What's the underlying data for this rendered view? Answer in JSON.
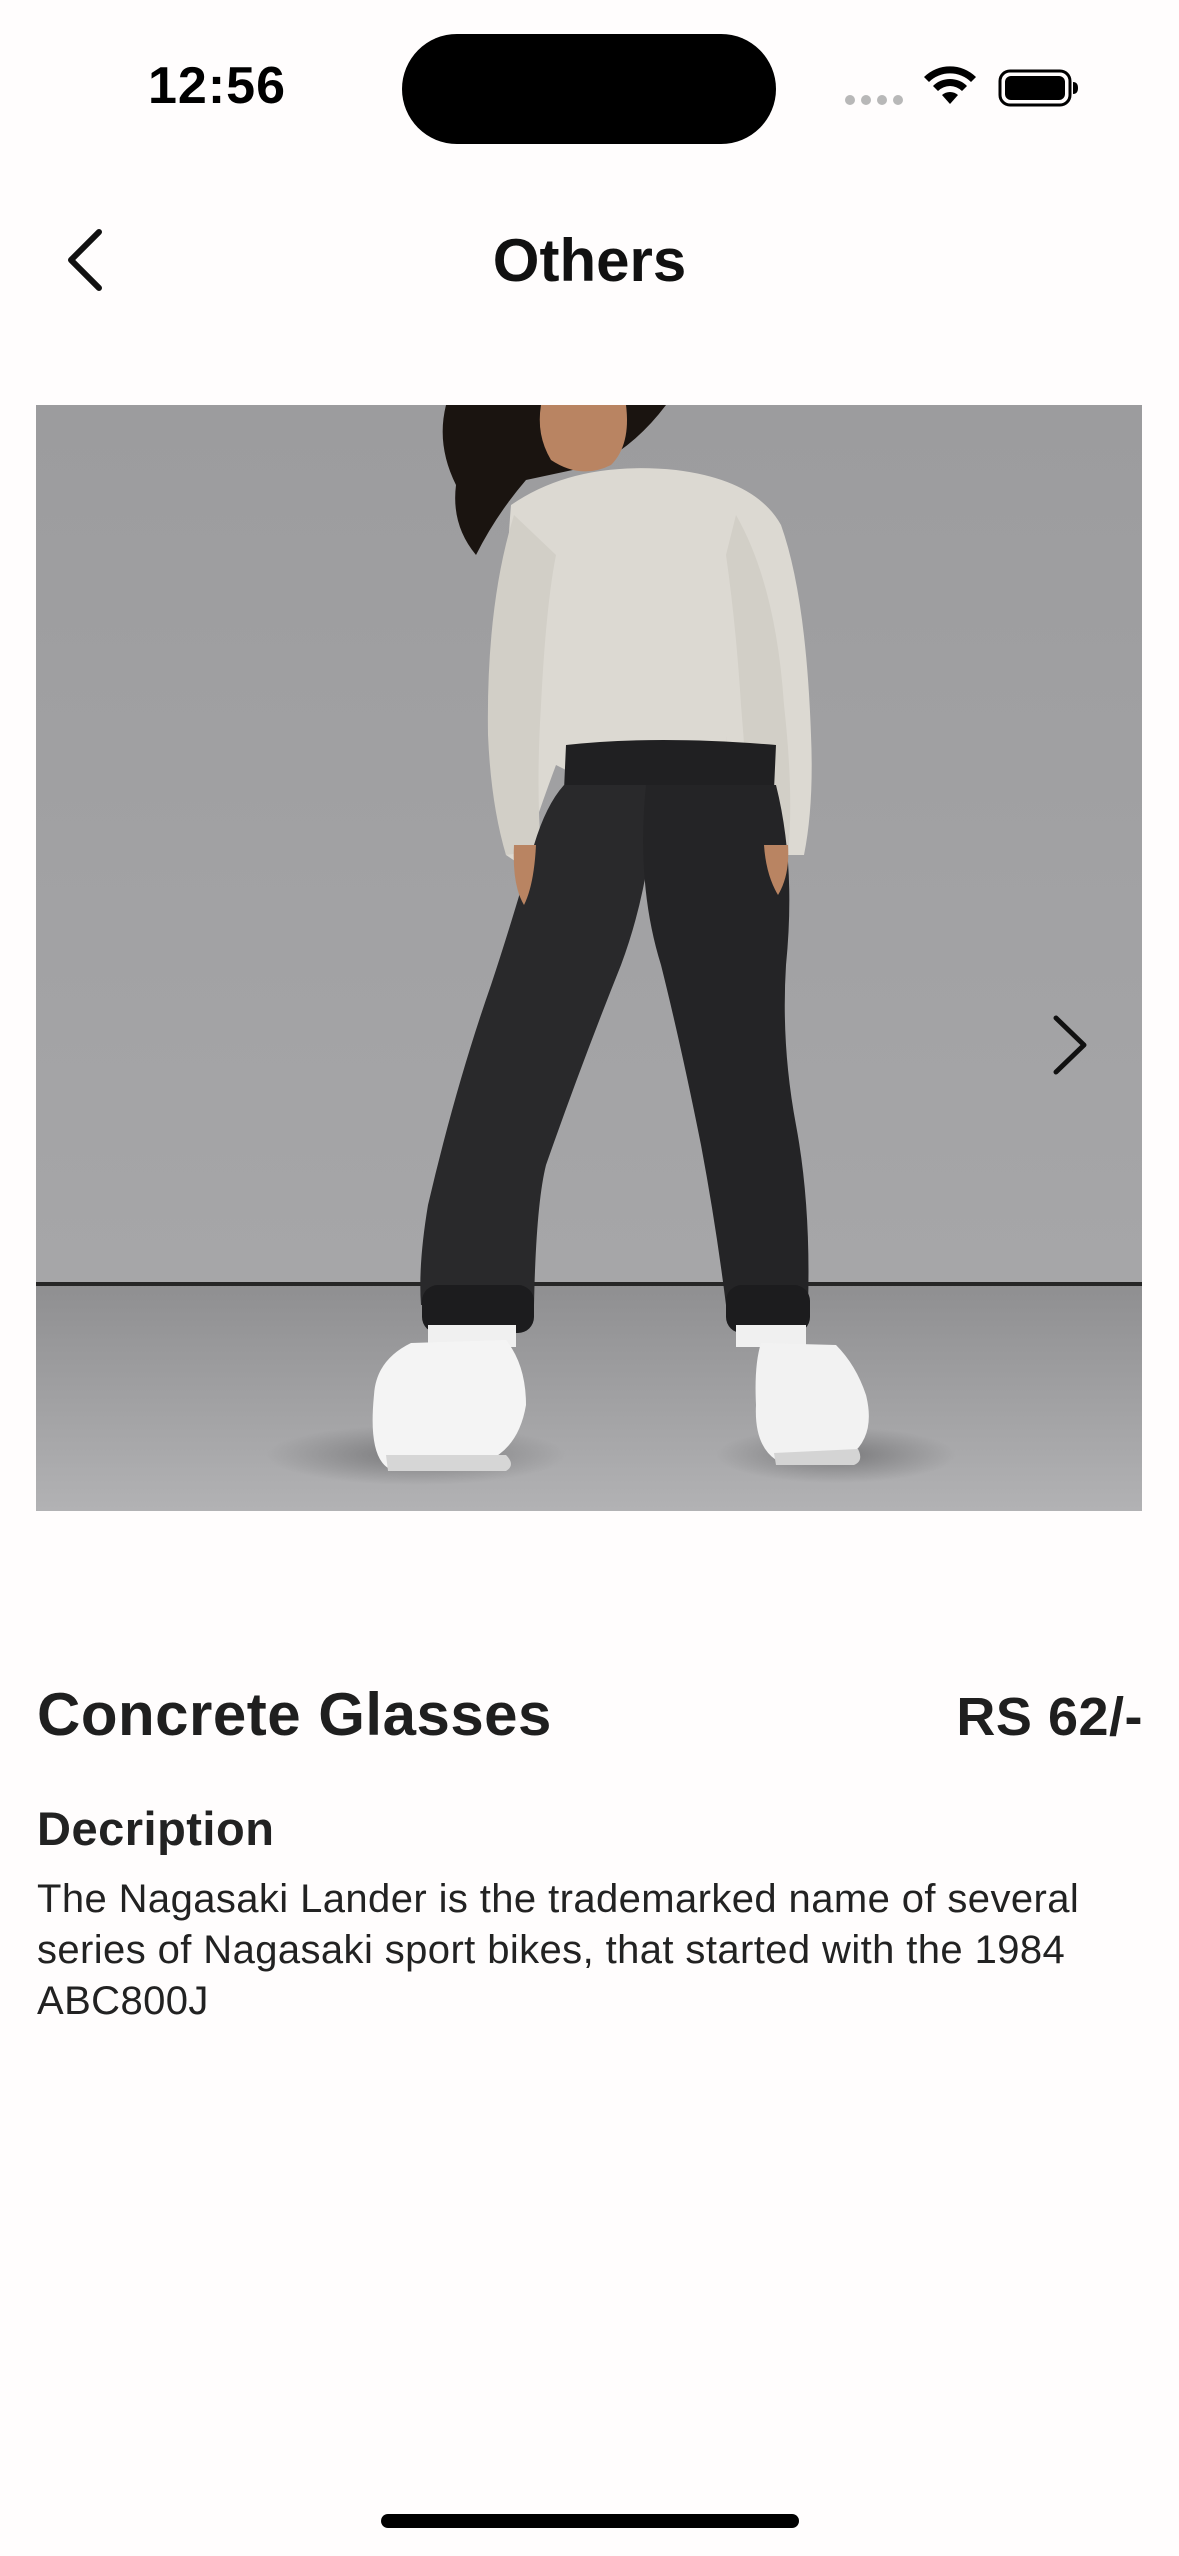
{
  "status_bar": {
    "time": "12:56"
  },
  "nav": {
    "title": "Others",
    "back_icon": "chevron-left-icon"
  },
  "product": {
    "image_alt": "Model wearing white sweatshirt and black joggers",
    "next_icon": "chevron-right-icon",
    "name": "Concrete Glasses",
    "price": "RS 62/-",
    "description_heading": "Decription",
    "description": "The Nagasaki Lander is the trademarked name of several series of Nagasaki sport bikes, that started with the 1984 ABC800J"
  },
  "colors": {
    "background": "#fffdfd",
    "text": "#1f1f1f",
    "photo_backdrop": "#a9a9ab"
  }
}
